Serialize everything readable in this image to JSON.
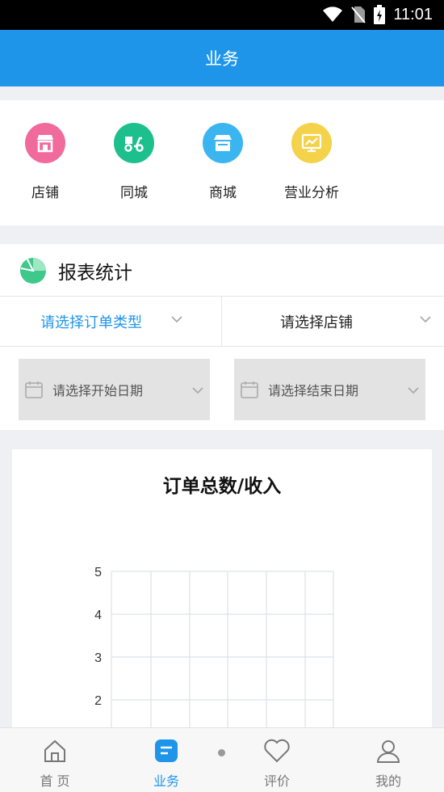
{
  "status": {
    "time": "11:01"
  },
  "header": {
    "title": "业务"
  },
  "quick": [
    {
      "label": "店铺",
      "icon": "store-icon",
      "color": "#f06b9c"
    },
    {
      "label": "同城",
      "icon": "delivery-icon",
      "color": "#1dbf8c"
    },
    {
      "label": "商城",
      "icon": "shop-icon",
      "color": "#3bb5f0"
    },
    {
      "label": "营业分析",
      "icon": "analysis-icon",
      "color": "#f4d24a"
    }
  ],
  "report": {
    "title": "报表统计",
    "order_type_placeholder": "请选择订单类型",
    "store_placeholder": "请选择店铺",
    "start_date_placeholder": "请选择开始日期",
    "end_date_placeholder": "请选择结束日期"
  },
  "chart_data": {
    "type": "line",
    "title": "订单总数/收入",
    "y_ticks": [
      "5",
      "4",
      "3",
      "2"
    ],
    "grid": true
  },
  "tabs": [
    {
      "label": "首 页",
      "icon": "home-icon",
      "active": false
    },
    {
      "label": "业务",
      "icon": "business-icon",
      "active": true
    },
    {
      "label": "评价",
      "icon": "heart-icon",
      "active": false
    },
    {
      "label": "我的",
      "icon": "user-icon",
      "active": false
    }
  ],
  "colors": {
    "accent": "#1f95ea",
    "report_icon": "#3ec98a"
  }
}
